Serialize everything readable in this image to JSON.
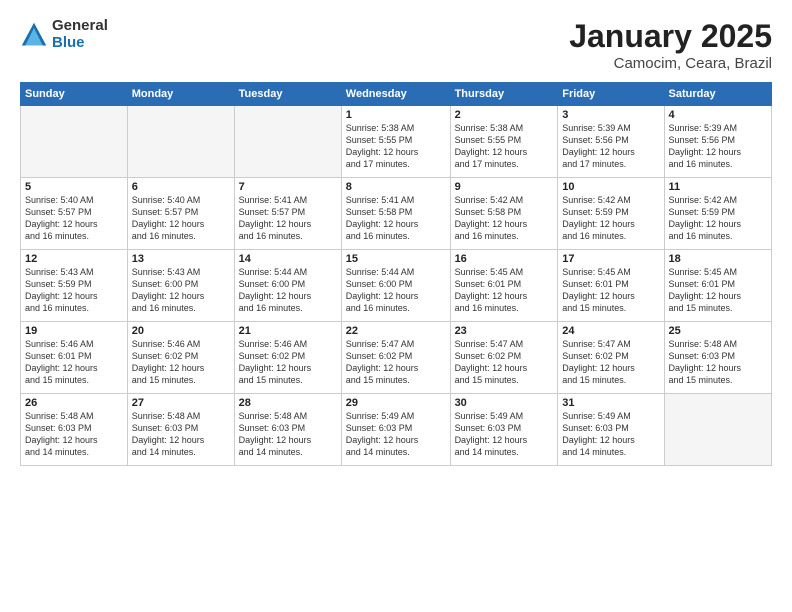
{
  "logo": {
    "general": "General",
    "blue": "Blue"
  },
  "title": {
    "month": "January 2025",
    "location": "Camocim, Ceara, Brazil"
  },
  "weekdays": [
    "Sunday",
    "Monday",
    "Tuesday",
    "Wednesday",
    "Thursday",
    "Friday",
    "Saturday"
  ],
  "weeks": [
    [
      {
        "day": "",
        "info": ""
      },
      {
        "day": "",
        "info": ""
      },
      {
        "day": "",
        "info": ""
      },
      {
        "day": "1",
        "info": "Sunrise: 5:38 AM\nSunset: 5:55 PM\nDaylight: 12 hours\nand 17 minutes."
      },
      {
        "day": "2",
        "info": "Sunrise: 5:38 AM\nSunset: 5:55 PM\nDaylight: 12 hours\nand 17 minutes."
      },
      {
        "day": "3",
        "info": "Sunrise: 5:39 AM\nSunset: 5:56 PM\nDaylight: 12 hours\nand 17 minutes."
      },
      {
        "day": "4",
        "info": "Sunrise: 5:39 AM\nSunset: 5:56 PM\nDaylight: 12 hours\nand 16 minutes."
      }
    ],
    [
      {
        "day": "5",
        "info": "Sunrise: 5:40 AM\nSunset: 5:57 PM\nDaylight: 12 hours\nand 16 minutes."
      },
      {
        "day": "6",
        "info": "Sunrise: 5:40 AM\nSunset: 5:57 PM\nDaylight: 12 hours\nand 16 minutes."
      },
      {
        "day": "7",
        "info": "Sunrise: 5:41 AM\nSunset: 5:57 PM\nDaylight: 12 hours\nand 16 minutes."
      },
      {
        "day": "8",
        "info": "Sunrise: 5:41 AM\nSunset: 5:58 PM\nDaylight: 12 hours\nand 16 minutes."
      },
      {
        "day": "9",
        "info": "Sunrise: 5:42 AM\nSunset: 5:58 PM\nDaylight: 12 hours\nand 16 minutes."
      },
      {
        "day": "10",
        "info": "Sunrise: 5:42 AM\nSunset: 5:59 PM\nDaylight: 12 hours\nand 16 minutes."
      },
      {
        "day": "11",
        "info": "Sunrise: 5:42 AM\nSunset: 5:59 PM\nDaylight: 12 hours\nand 16 minutes."
      }
    ],
    [
      {
        "day": "12",
        "info": "Sunrise: 5:43 AM\nSunset: 5:59 PM\nDaylight: 12 hours\nand 16 minutes."
      },
      {
        "day": "13",
        "info": "Sunrise: 5:43 AM\nSunset: 6:00 PM\nDaylight: 12 hours\nand 16 minutes."
      },
      {
        "day": "14",
        "info": "Sunrise: 5:44 AM\nSunset: 6:00 PM\nDaylight: 12 hours\nand 16 minutes."
      },
      {
        "day": "15",
        "info": "Sunrise: 5:44 AM\nSunset: 6:00 PM\nDaylight: 12 hours\nand 16 minutes."
      },
      {
        "day": "16",
        "info": "Sunrise: 5:45 AM\nSunset: 6:01 PM\nDaylight: 12 hours\nand 16 minutes."
      },
      {
        "day": "17",
        "info": "Sunrise: 5:45 AM\nSunset: 6:01 PM\nDaylight: 12 hours\nand 15 minutes."
      },
      {
        "day": "18",
        "info": "Sunrise: 5:45 AM\nSunset: 6:01 PM\nDaylight: 12 hours\nand 15 minutes."
      }
    ],
    [
      {
        "day": "19",
        "info": "Sunrise: 5:46 AM\nSunset: 6:01 PM\nDaylight: 12 hours\nand 15 minutes."
      },
      {
        "day": "20",
        "info": "Sunrise: 5:46 AM\nSunset: 6:02 PM\nDaylight: 12 hours\nand 15 minutes."
      },
      {
        "day": "21",
        "info": "Sunrise: 5:46 AM\nSunset: 6:02 PM\nDaylight: 12 hours\nand 15 minutes."
      },
      {
        "day": "22",
        "info": "Sunrise: 5:47 AM\nSunset: 6:02 PM\nDaylight: 12 hours\nand 15 minutes."
      },
      {
        "day": "23",
        "info": "Sunrise: 5:47 AM\nSunset: 6:02 PM\nDaylight: 12 hours\nand 15 minutes."
      },
      {
        "day": "24",
        "info": "Sunrise: 5:47 AM\nSunset: 6:02 PM\nDaylight: 12 hours\nand 15 minutes."
      },
      {
        "day": "25",
        "info": "Sunrise: 5:48 AM\nSunset: 6:03 PM\nDaylight: 12 hours\nand 15 minutes."
      }
    ],
    [
      {
        "day": "26",
        "info": "Sunrise: 5:48 AM\nSunset: 6:03 PM\nDaylight: 12 hours\nand 14 minutes."
      },
      {
        "day": "27",
        "info": "Sunrise: 5:48 AM\nSunset: 6:03 PM\nDaylight: 12 hours\nand 14 minutes."
      },
      {
        "day": "28",
        "info": "Sunrise: 5:48 AM\nSunset: 6:03 PM\nDaylight: 12 hours\nand 14 minutes."
      },
      {
        "day": "29",
        "info": "Sunrise: 5:49 AM\nSunset: 6:03 PM\nDaylight: 12 hours\nand 14 minutes."
      },
      {
        "day": "30",
        "info": "Sunrise: 5:49 AM\nSunset: 6:03 PM\nDaylight: 12 hours\nand 14 minutes."
      },
      {
        "day": "31",
        "info": "Sunrise: 5:49 AM\nSunset: 6:03 PM\nDaylight: 12 hours\nand 14 minutes."
      },
      {
        "day": "",
        "info": ""
      }
    ]
  ]
}
